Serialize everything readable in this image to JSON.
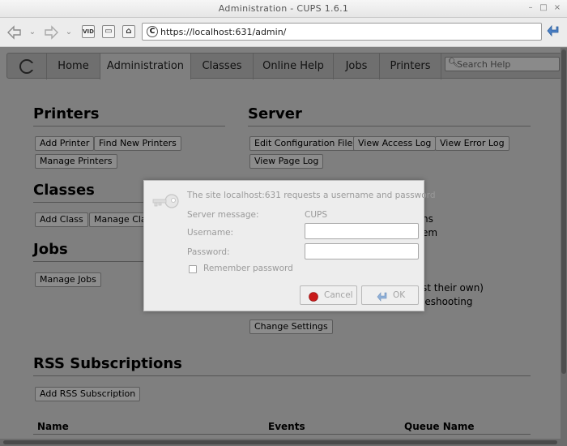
{
  "window": {
    "title": "Administration - CUPS 1.6.1",
    "minimize": "–",
    "maximize": "□",
    "close": "×"
  },
  "browser": {
    "back_icon": "back-arrow-icon",
    "forward_icon": "forward-arrow-icon",
    "url": "https://localhost:631/admin/",
    "url_badge": "C",
    "vid_badge": "VID"
  },
  "tabs": [
    {
      "label": "Home"
    },
    {
      "label": "Administration"
    },
    {
      "label": "Classes"
    },
    {
      "label": "Online Help"
    },
    {
      "label": "Jobs"
    },
    {
      "label": "Printers"
    }
  ],
  "search": {
    "placeholder": "Search Help"
  },
  "printers": {
    "title": "Printers",
    "add": "Add Printer",
    "find": "Find New Printers",
    "manage": "Manage Printers"
  },
  "classes": {
    "title": "Classes",
    "add": "Add Class",
    "manage": "Manage Cla"
  },
  "jobs": {
    "title": "Jobs",
    "manage": "Manage Jobs"
  },
  "server": {
    "title": "Server",
    "edit_config": "Edit Configuration File",
    "view_access": "View Access Log",
    "view_error": "View Error Log",
    "view_page": "View Page Log",
    "frag1": "ns",
    "frag2": "em",
    "frag3": "st their own)",
    "frag4": "leshooting",
    "change_settings": "Change Settings"
  },
  "rss": {
    "title": "RSS Subscriptions",
    "add": "Add RSS Subscription",
    "columns": [
      "Name",
      "Events",
      "Queue Name"
    ]
  },
  "dialog": {
    "message": "The site localhost:631 requests a username and password",
    "server_message_label": "Server message:",
    "server_message_value": "CUPS",
    "username_label": "Username:",
    "password_label": "Password:",
    "remember_label": "Remember password",
    "cancel": "Cancel",
    "ok": "OK"
  }
}
